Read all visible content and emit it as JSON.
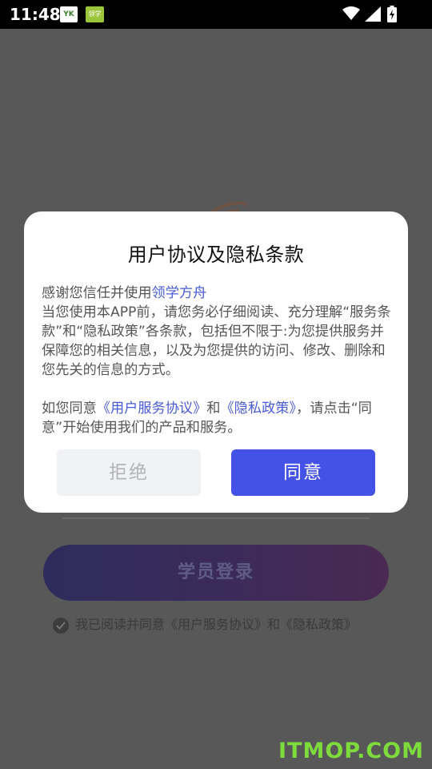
{
  "status_bar": {
    "time": "11:48",
    "app_icon_1": "YK",
    "app_icon_2": "领学",
    "icons": [
      "wifi-icon",
      "signal-icon",
      "battery-icon"
    ]
  },
  "background": {
    "login_button": "学员登录",
    "agreement_text": "我已阅读并同意《用户服务协议》和《隐私政策》",
    "watermark": "ITMOP.COM"
  },
  "dialog": {
    "title": "用户协议及隐私条款",
    "para1_prefix": "感谢您信任并使用",
    "para1_app_link": "领学方舟",
    "para1_text": "当您使用本APP前，请您务必仔细阅读、充分理解“服务条款”和“隐私政策”各条款，包括但不限于:为您提供服务并保障您的相关信息，以及为您提供的访问、修改、删除和您先关的信息的方式。",
    "para2_prefix": "如您同意",
    "para2_link1": "《用户服务协议》",
    "para2_and": "和",
    "para2_link2": "《隐私政策》",
    "para2_suffix": "，请点击“同意”开始使用我们的产品和服务。",
    "refuse_label": "拒绝",
    "agree_label": "同意"
  },
  "colors": {
    "accent": "#4452e8",
    "link": "#4a5bd6",
    "overlay_bg": "#585858"
  }
}
